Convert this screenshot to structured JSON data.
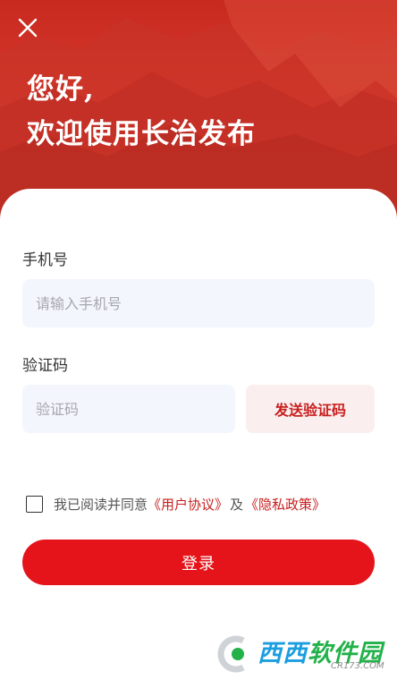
{
  "header": {
    "close_icon": "close-icon",
    "greeting_line1": "您好,",
    "greeting_line2": "欢迎使用长治发布",
    "background_color": "#d93a2c"
  },
  "form": {
    "phone_label": "手机号",
    "phone_placeholder": "请输入手机号",
    "phone_value": "",
    "code_label": "验证码",
    "code_placeholder": "验证码",
    "code_value": "",
    "send_code_label": "发送验证码"
  },
  "agreement": {
    "checked": false,
    "prefix": "我已阅读并同意",
    "user_agreement": "《用户协议》",
    "conjunction": "及",
    "privacy_policy": "《隐私政策》"
  },
  "login_label": "登录",
  "accent_color": "#e4141a",
  "watermark": {
    "text_a": "西西",
    "text_b": "软件园",
    "sub": "CR173.COM"
  }
}
